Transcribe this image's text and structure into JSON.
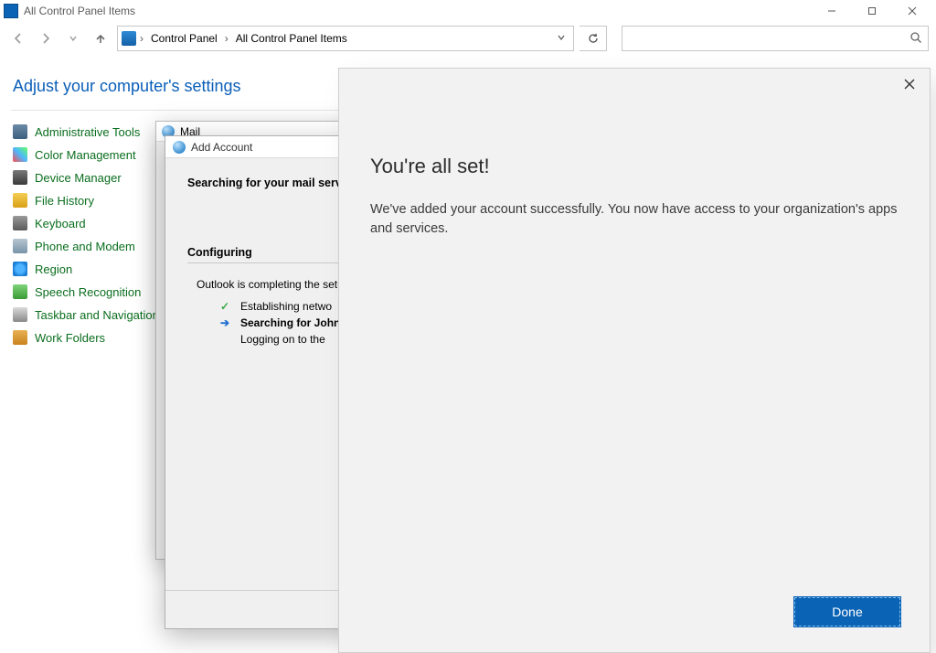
{
  "window": {
    "title": "All Control Panel Items",
    "heading": "Adjust your computer's settings"
  },
  "breadcrumb": {
    "seg1": "Control Panel",
    "seg2": "All Control Panel Items"
  },
  "search": {
    "placeholder": ""
  },
  "cpitems": [
    {
      "label": "Administrative Tools"
    },
    {
      "label": "Color Management"
    },
    {
      "label": "Device Manager"
    },
    {
      "label": "File History"
    },
    {
      "label": "Keyboard"
    },
    {
      "label": "Phone and Modem"
    },
    {
      "label": "Region"
    },
    {
      "label": "Speech Recognition"
    },
    {
      "label": "Taskbar and Navigation"
    },
    {
      "label": "Work Folders"
    }
  ],
  "mail_dialog": {
    "title": "Mail"
  },
  "add_account": {
    "title": "Add Account",
    "searching": "Searching for your mail serv",
    "configuring": "Configuring",
    "message": "Outlook is completing the setu",
    "step1": "Establishing netwo",
    "step2": "Searching for John",
    "step3": "Logging on to the"
  },
  "modal": {
    "title": "You're all set!",
    "body": "We've added your account successfully. You now have access to your organization's apps and services.",
    "done": "Done"
  }
}
